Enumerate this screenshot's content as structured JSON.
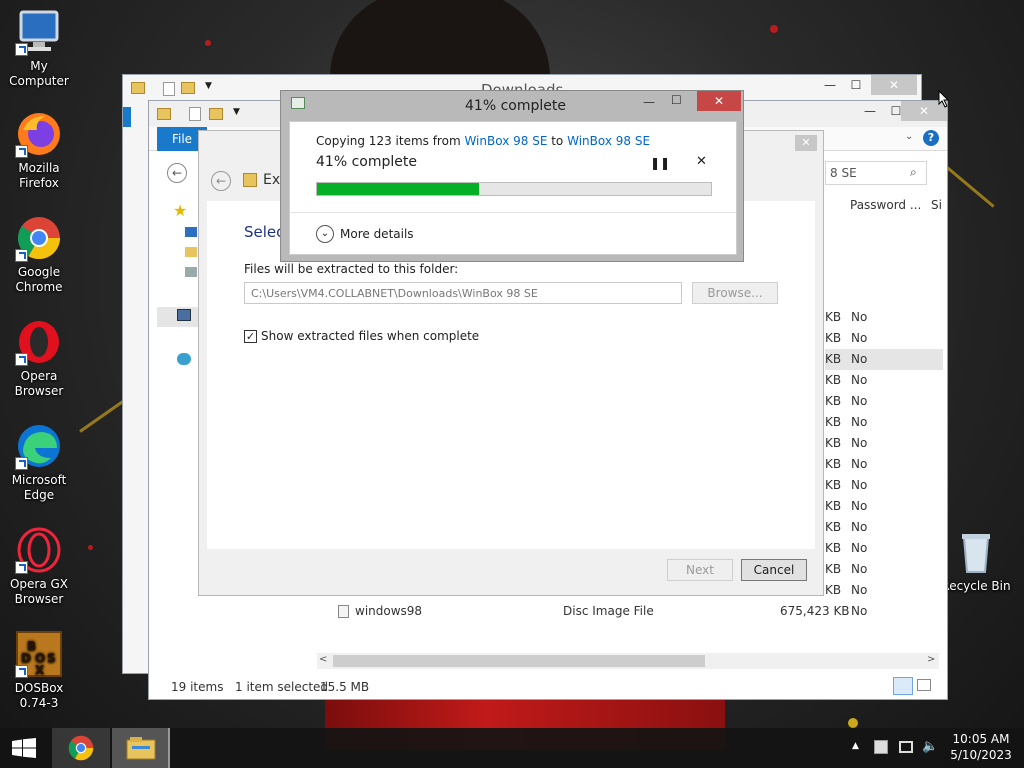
{
  "desktop": {
    "icons": [
      {
        "label": "My Computer"
      },
      {
        "label": "Mozilla Firefox"
      },
      {
        "label": "Google Chrome"
      },
      {
        "label": "Opera Browser"
      },
      {
        "label": "Microsoft Edge"
      },
      {
        "label": "Opera GX Browser"
      },
      {
        "label": "DOSBox 0.74-3"
      }
    ],
    "recycle_bin": "Recycle Bin"
  },
  "explorer": {
    "title": "Downloads",
    "file_tab": "File",
    "search_placeholder": "8 SE",
    "columns": {
      "password": "Password ...",
      "size": "Si"
    },
    "rows_tail": [
      "KB",
      "KB",
      "KB",
      "KB",
      "KB",
      "KB",
      "KB",
      "KB",
      "KB",
      "KB",
      "KB",
      "KB",
      "KB",
      "KB"
    ],
    "rows_pw": [
      "No",
      "No",
      "No",
      "No",
      "No",
      "No",
      "No",
      "No",
      "No",
      "No",
      "No",
      "No",
      "No",
      "No"
    ],
    "last_row": {
      "name": "windows98",
      "type": "Disc Image File",
      "size": "675,423 KB",
      "password": "No"
    },
    "status": {
      "count": "19 items",
      "selected": "1 item selected",
      "size": "15.5 MB"
    }
  },
  "extract": {
    "crumb": "Ext",
    "heading": "Select",
    "folder_label": "Files will be extracted to this folder:",
    "path": "C:\\Users\\VM4.COLLABNET\\Downloads\\WinBox 98 SE",
    "browse": "Browse...",
    "show_files": "Show extracted files when complete",
    "next": "Next",
    "cancel": "Cancel"
  },
  "progress": {
    "title": "41% complete",
    "copy_prefix": "Copying 123 items from ",
    "source": "WinBox 98 SE",
    "to": " to ",
    "dest": "WinBox 98 SE",
    "status": "41% complete",
    "percent": 41,
    "more_details": "More details"
  },
  "taskbar": {
    "time": "10:05 AM",
    "date": "5/10/2023"
  }
}
